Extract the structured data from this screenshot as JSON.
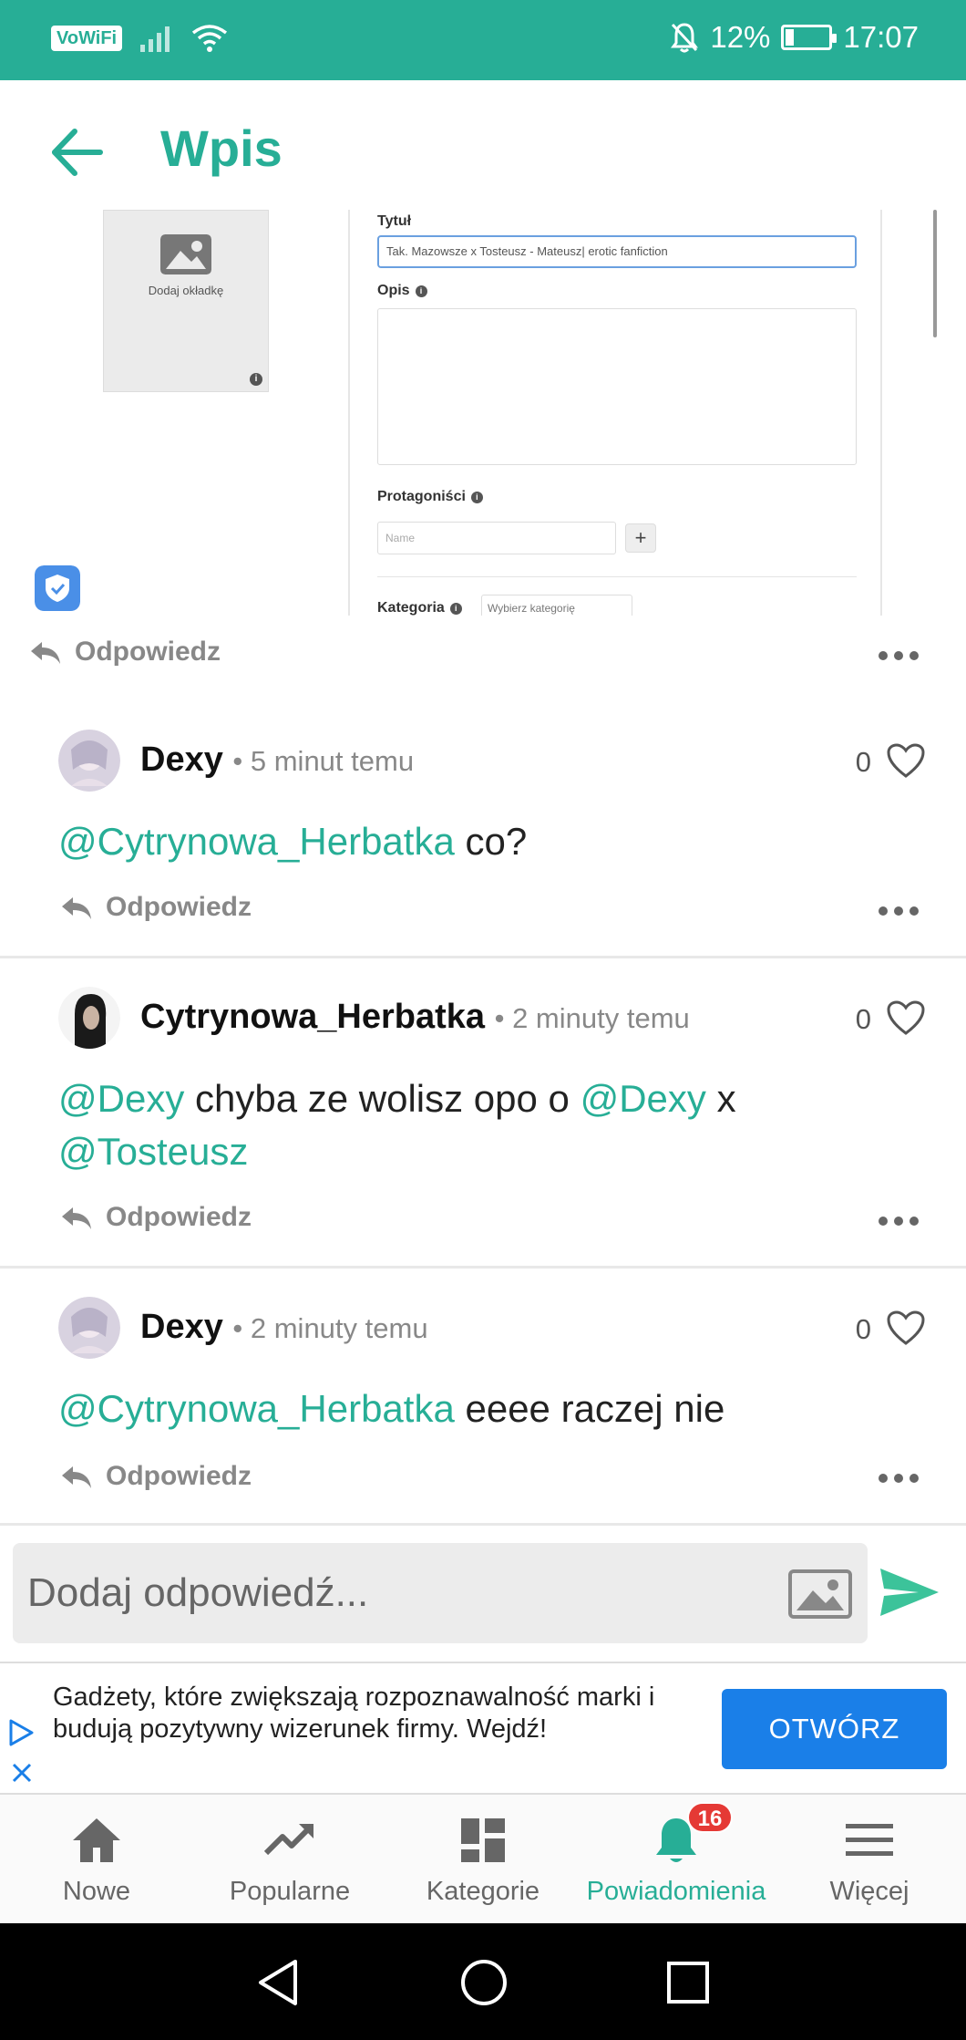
{
  "status_bar": {
    "vowifi": "VoWiFi",
    "battery_percent": "12%",
    "time": "17:07",
    "icons": [
      "signal-icon",
      "wifi-icon",
      "silent-bell-icon",
      "battery-icon"
    ]
  },
  "header": {
    "title": "Wpis"
  },
  "attachment": {
    "cover_label": "Dodaj okładkę",
    "title_label": "Tytuł",
    "title_value": "Tak. Mazowsze x Tosteusz - Mateusz| erotic fanfiction",
    "description_label": "Opis",
    "protagonists_label": "Protagoniści",
    "name_placeholder": "Name",
    "plus_label": "+",
    "category_label": "Kategoria",
    "category_placeholder": "Wybierz kategorię"
  },
  "post_actions": {
    "reply_label": "Odpowiedz"
  },
  "comments": [
    {
      "author": "Dexy",
      "time": "5 minut temu",
      "likes": "0",
      "mentions": [
        "@Cytrynowa_Herbatka"
      ],
      "text": "co?",
      "reply_label": "Odpowiedz"
    },
    {
      "author": "Cytrynowa_Herbatka",
      "time": "2 minuty temu",
      "likes": "0",
      "mention_1": "@Dexy",
      "text_1": "chyba ze wolisz opo o",
      "mention_2": "@Dexy",
      "text_2": "x",
      "mention_3": "@Tosteusz",
      "reply_label": "Odpowiedz"
    },
    {
      "author": "Dexy",
      "time": "2 minuty temu",
      "likes": "0",
      "mentions": [
        "@Cytrynowa_Herbatka"
      ],
      "text": "eeee raczej nie",
      "reply_label": "Odpowiedz"
    }
  ],
  "reply_input": {
    "placeholder": "Dodaj odpowiedź..."
  },
  "ad": {
    "text": "Gadżety, które zwiększają rozpoznawalność marki i budują pozytywny wizerunek firmy. Wejdź!",
    "button": "OTWÓRZ"
  },
  "bottom_nav": {
    "items": [
      {
        "label": "Nowe",
        "icon": "home-icon"
      },
      {
        "label": "Popularne",
        "icon": "trending-icon"
      },
      {
        "label": "Kategorie",
        "icon": "dashboard-icon"
      },
      {
        "label": "Powiadomienia",
        "icon": "bell-icon",
        "active": true
      },
      {
        "label": "Więcej",
        "icon": "menu-icon"
      }
    ],
    "notification_count": "16"
  },
  "colors": {
    "accent": "#27ae96",
    "ad_button": "#1a7fe8",
    "badge": "#e53935"
  }
}
